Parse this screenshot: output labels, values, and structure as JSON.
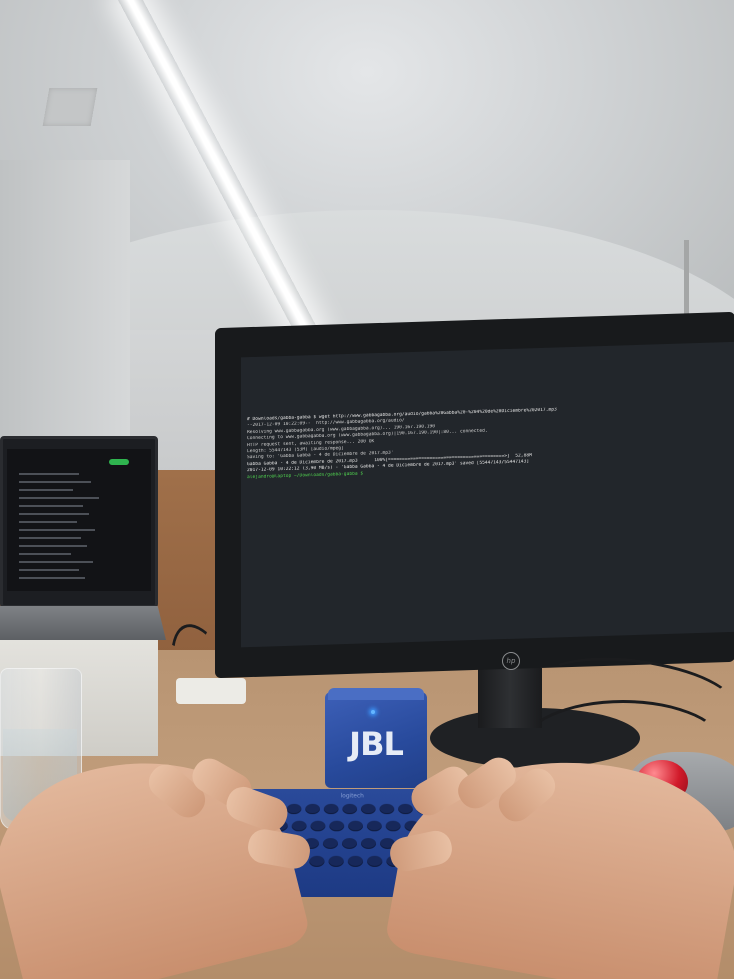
{
  "speaker": {
    "brand": "JBL"
  },
  "keyboard": {
    "brand": "logitech"
  },
  "monitor": {
    "logo": "hp"
  },
  "terminal": {
    "lines": [
      {
        "text": "# Downloads/gabba-gabba $ wget http://www.gabbagabba.org/audio/gabba%20Gabba%20-%204%20de%20Diciembre%202017.mp3",
        "color": "#e6e6e6"
      },
      {
        "text": "--2017-12-09 10:22:09--  http://www.gabbagabba.org/audio/",
        "color": "#d0d0d0"
      },
      {
        "text": "Resolving www.gabbagabba.org (www.gabbagabba.org)... 190.167.190.190",
        "color": "#d0d0d0"
      },
      {
        "text": "Connecting to www.gabbagabba.org (www.gabbagabba.org)|190.167.190.190|:80... connected.",
        "color": "#d0d0d0"
      },
      {
        "text": "HTTP request sent, awaiting response... 200 OK",
        "color": "#d0d0d0"
      },
      {
        "text": "Length: 55447143 (53M) [audio/mpeg]",
        "color": "#d0d0d0"
      },
      {
        "text": "Saving to: 'Gabba Gabba - 4 de Diciembre de 2017.mp3'",
        "color": "#d0d0d0"
      },
      {
        "text": "Gabba Gabba - 4 de Diciembre de 2017.mp3      100%[==========================================>]  52,88M",
        "color": "#e6e6e6"
      },
      {
        "text": "2017-12-09 10:22:12 (3,90 MB/s) - 'Gabba Gabba - 4 de Diciembre de 2017.mp3' saved [55447143/55447143]",
        "color": "#e6e6e6"
      },
      {
        "text": "alejandro@laptop ~/Downloads/gabba-gabba $",
        "color": "#4fd04f"
      }
    ]
  }
}
